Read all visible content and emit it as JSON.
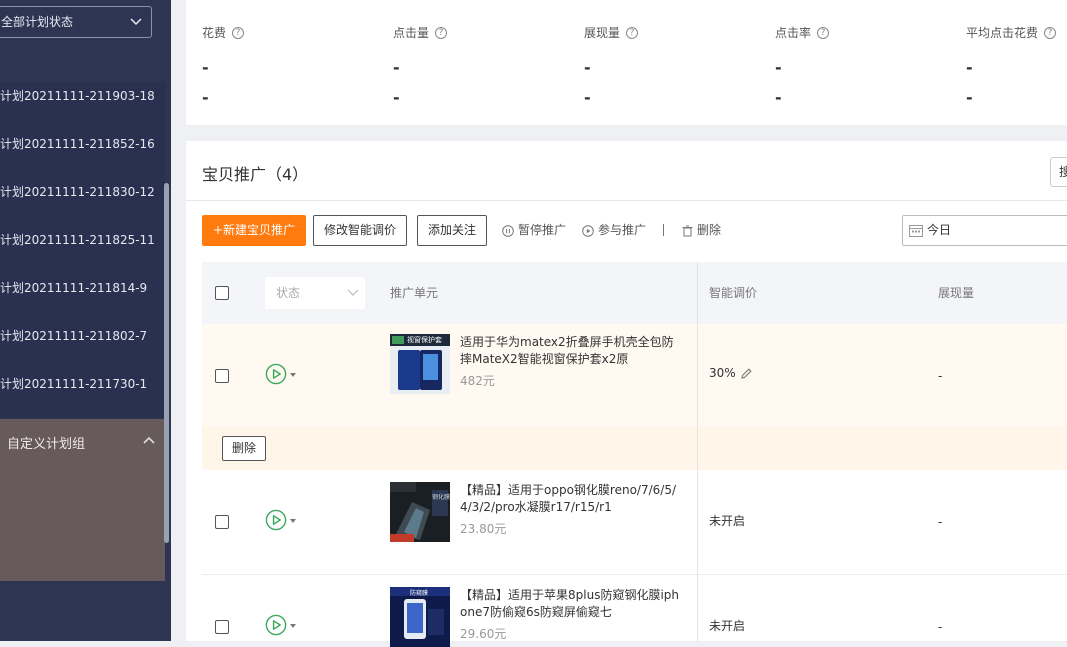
{
  "sidebar": {
    "status_select": "全部计划状态",
    "plans": [
      "计划20211111-211903-18",
      "计划20211111-211852-16",
      "计划20211111-211830-12",
      "计划20211111-211825-11",
      "计划20211111-211814-9",
      "计划20211111-211802-7",
      "计划20211111-211730-1"
    ],
    "custom_group": "自定义计划组"
  },
  "stats": [
    {
      "title": "花费",
      "v1": "-",
      "v2": "-"
    },
    {
      "title": "点击量",
      "v1": "-",
      "v2": "-"
    },
    {
      "title": "展现量",
      "v1": "-",
      "v2": "-"
    },
    {
      "title": "点击率",
      "v1": "-",
      "v2": "-"
    },
    {
      "title": "平均点击花费",
      "v1": "-",
      "v2": "-"
    }
  ],
  "main": {
    "title": "宝贝推广（4）",
    "top_right_btn": "搜",
    "toolbar": {
      "new": "+新建宝贝推广",
      "modify_bid": "修改智能调价",
      "follow": "添加关注",
      "pause": "暂停推广",
      "join": "参与推广",
      "delete": "删除"
    },
    "date": "今日"
  },
  "table": {
    "status_filter": "状态",
    "headers": {
      "unit": "推广单元",
      "bid": "智能调价",
      "impr": "展现量"
    },
    "delete_btn": "删除",
    "rows": [
      {
        "name": "适用于华为matex2折叠屏手机壳全包防摔MateX2智能视窗保护套x2原",
        "price": "482元",
        "bid": "30%",
        "impr": "-",
        "thumb_text": "视窗保护套"
      },
      {
        "name": "【精品】适用于oppo钢化膜reno/7/6/5/4/3/2/pro水凝膜r17/r15/r1",
        "price": "23.80元",
        "bid": "未开启",
        "impr": "-",
        "thumb_text": "钢化膜"
      },
      {
        "name": "【精品】适用于苹果8plus防窥钢化膜iphone7防偷窥6s防窥屏偷窥七",
        "price": "29.60元",
        "bid": "未开启",
        "impr": "-",
        "thumb_text": "防窥膜"
      }
    ]
  },
  "colors": {
    "sidebar": "#2d3553",
    "accent": "#ff7a0f",
    "group": "#675a5a"
  }
}
